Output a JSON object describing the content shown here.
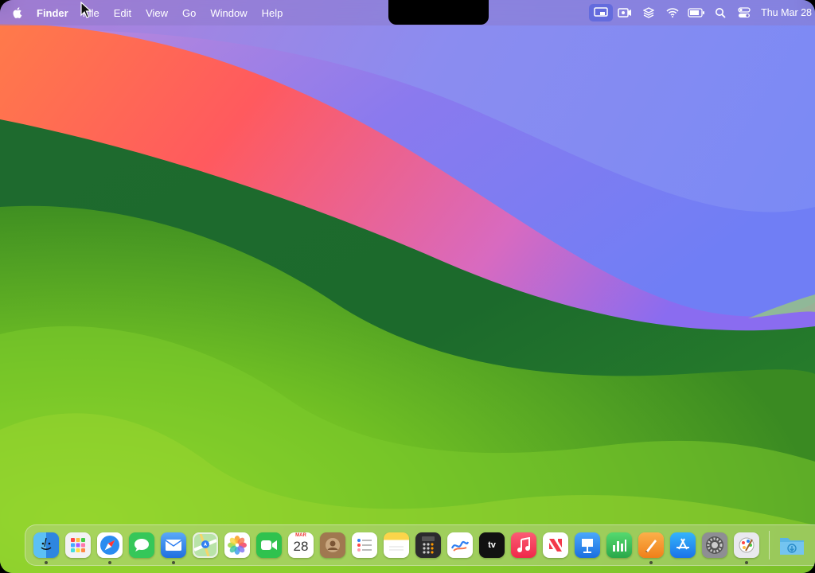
{
  "menubar": {
    "apple_icon": "apple-logo-icon",
    "app_name": "Finder",
    "items": [
      "File",
      "Edit",
      "View",
      "Go",
      "Window",
      "Help"
    ],
    "status_icons": [
      "screen-mirroring-icon",
      "screen-record-icon",
      "layers-icon",
      "wifi-icon",
      "battery-icon",
      "search-icon",
      "control-center-icon"
    ],
    "clock": "Thu Mar 28"
  },
  "dock": {
    "apps": [
      {
        "name": "finder",
        "color": "#3b9cf0",
        "running": true
      },
      {
        "name": "launchpad",
        "color": "#f0f0f0",
        "running": false
      },
      {
        "name": "safari",
        "color": "#2a8cf0",
        "running": true
      },
      {
        "name": "messages",
        "color": "#35c759",
        "running": false
      },
      {
        "name": "mail",
        "color": "#2f7ff2",
        "running": true
      },
      {
        "name": "maps",
        "color": "#63c87a",
        "running": false
      },
      {
        "name": "photos",
        "color": "#ffffff",
        "running": false
      },
      {
        "name": "facetime",
        "color": "#2fc24e",
        "running": false
      },
      {
        "name": "calendar",
        "color": "#ffffff",
        "running": false
      },
      {
        "name": "contacts",
        "color": "#a07850",
        "running": false
      },
      {
        "name": "reminders",
        "color": "#ffffff",
        "running": false
      },
      {
        "name": "notes",
        "color": "#fbe27a",
        "running": false
      },
      {
        "name": "calculator",
        "color": "#d0d0d0",
        "running": false
      },
      {
        "name": "freeform",
        "color": "#ffffff",
        "running": false
      },
      {
        "name": "apple-tv",
        "color": "#111111",
        "running": false
      },
      {
        "name": "music",
        "color": "#f23e57",
        "running": false
      },
      {
        "name": "news",
        "color": "#ffffff",
        "running": false
      },
      {
        "name": "keynote",
        "color": "#2f8cf5",
        "running": false
      },
      {
        "name": "numbers",
        "color": "#34c759",
        "running": false
      },
      {
        "name": "pages",
        "color": "#f79a2b",
        "running": true
      },
      {
        "name": "app-store",
        "color": "#1f8cf2",
        "running": false
      },
      {
        "name": "system-settings",
        "color": "#8e8e93",
        "running": false
      },
      {
        "name": "script-editor",
        "color": "#e9e9ee",
        "running": true
      }
    ],
    "calendar_month": "MAR",
    "calendar_day": "28",
    "tv_label": "tv",
    "folder": {
      "name": "downloads-folder",
      "color": "#5ab4e6"
    }
  }
}
